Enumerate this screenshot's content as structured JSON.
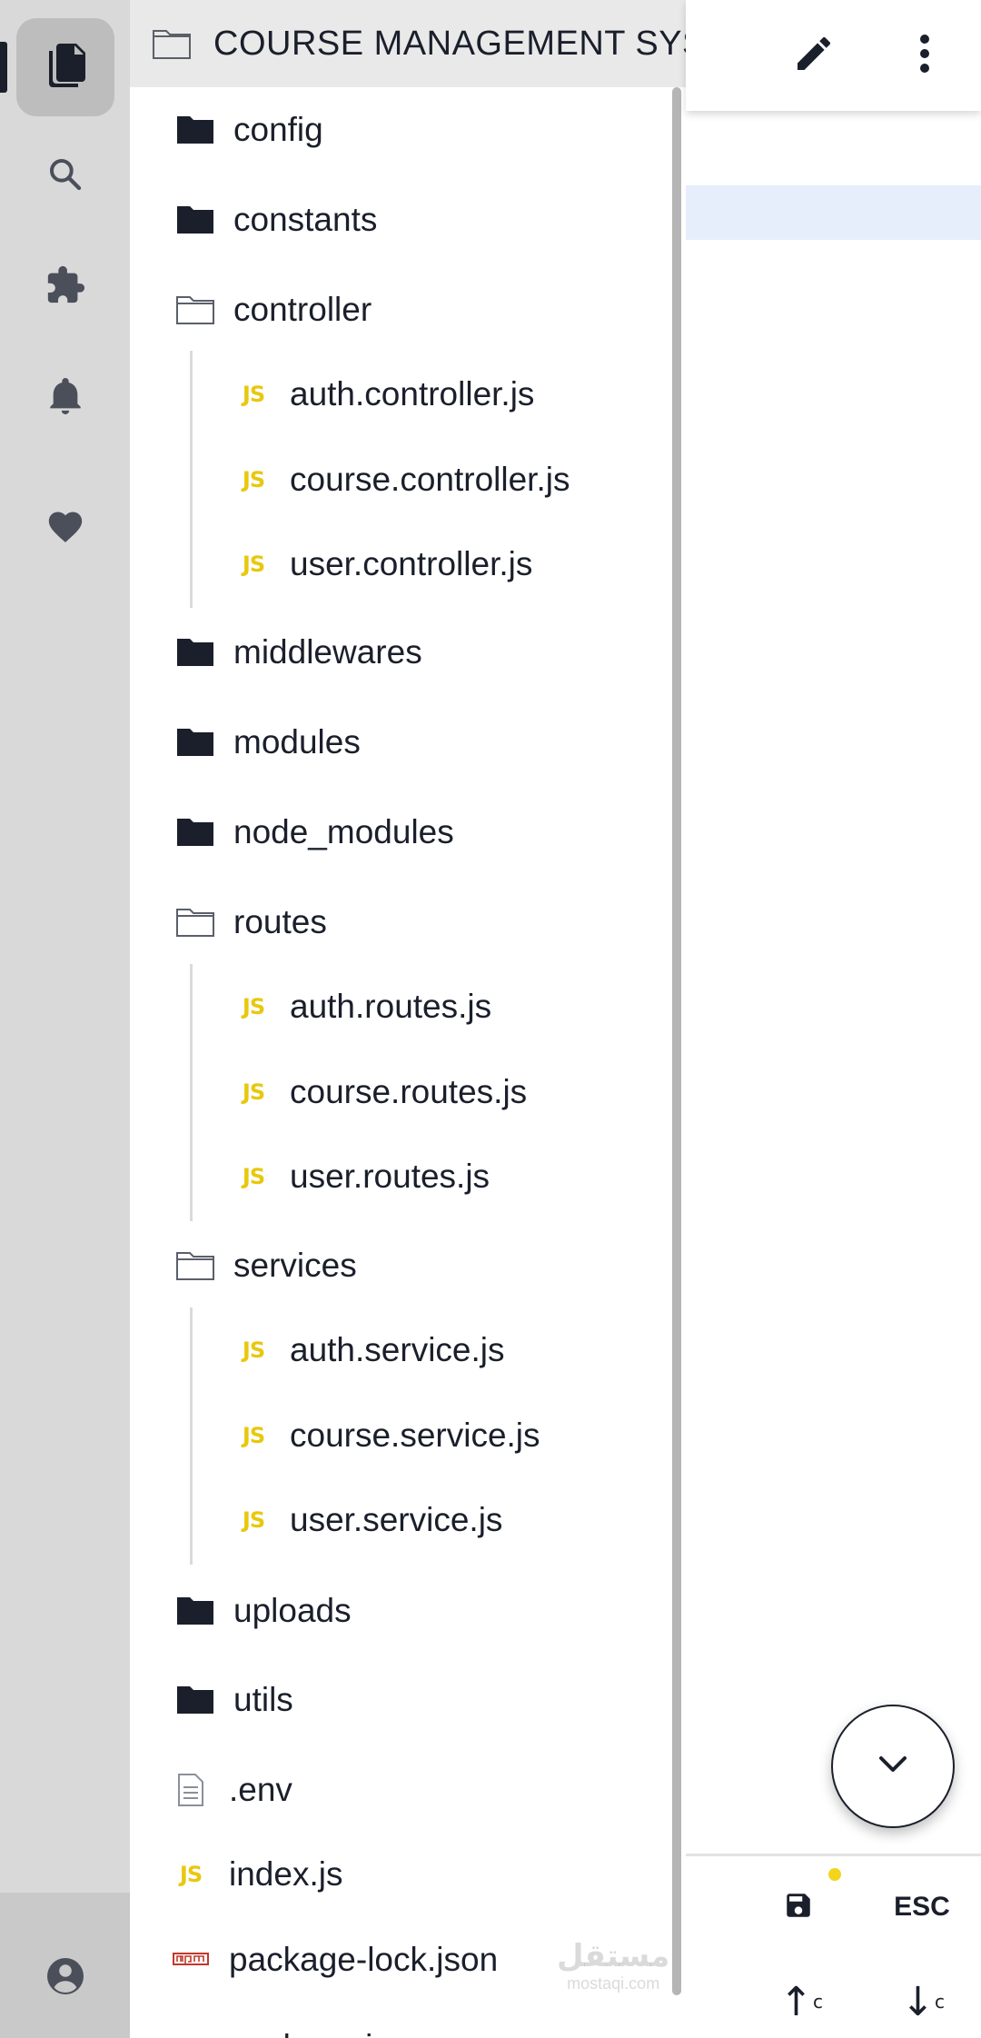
{
  "activity_bar": {
    "items": [
      {
        "name": "explorer",
        "icon": "files-icon"
      },
      {
        "name": "search",
        "icon": "search-icon"
      },
      {
        "name": "extensions",
        "icon": "puzzle-icon"
      },
      {
        "name": "notifications",
        "icon": "bell-icon"
      },
      {
        "name": "favorites",
        "icon": "heart-icon"
      }
    ],
    "account_icon": "account-icon"
  },
  "explorer": {
    "title": "COURSE MANAGEMENT SYSTEM",
    "items": [
      {
        "label": "config",
        "type": "folder-closed"
      },
      {
        "label": "constants",
        "type": "folder-closed"
      },
      {
        "label": "controller",
        "type": "folder-open"
      },
      {
        "label": "auth.controller.js",
        "type": "js"
      },
      {
        "label": "course.controller.js",
        "type": "js"
      },
      {
        "label": "user.controller.js",
        "type": "js"
      },
      {
        "label": "middlewares",
        "type": "folder-closed"
      },
      {
        "label": "modules",
        "type": "folder-closed"
      },
      {
        "label": "node_modules",
        "type": "folder-closed"
      },
      {
        "label": "routes",
        "type": "folder-open"
      },
      {
        "label": "auth.routes.js",
        "type": "js"
      },
      {
        "label": "course.routes.js",
        "type": "js"
      },
      {
        "label": "user.routes.js",
        "type": "js"
      },
      {
        "label": "services",
        "type": "folder-open"
      },
      {
        "label": "auth.service.js",
        "type": "js"
      },
      {
        "label": "course.service.js",
        "type": "js"
      },
      {
        "label": "user.service.js",
        "type": "js"
      },
      {
        "label": "uploads",
        "type": "folder-closed"
      },
      {
        "label": "utils",
        "type": "folder-closed"
      },
      {
        "label": ".env",
        "type": "text-file"
      },
      {
        "label": "index.js",
        "type": "js"
      },
      {
        "label": "package-lock.json",
        "type": "npm"
      },
      {
        "label": "package.json",
        "type": "npm"
      }
    ],
    "js_badge": "JS"
  },
  "editor": {
    "edit_icon": "pencil-icon",
    "menu_icon": "more-vertical-icon",
    "fab_icon": "chevron-down-icon",
    "save_icon": "save-icon",
    "esc_label": "ESC",
    "up_key": "↑",
    "down_key": "↓",
    "key_mod": "c"
  },
  "watermark": {
    "text": "مستقل",
    "sub": "mostaqi.com"
  },
  "colors": {
    "activity_bg": "#d9d9d9",
    "header_bg": "#e9e9e9",
    "js_yellow": "#e8c80f",
    "folder_dark": "#1a1f2b",
    "highlight": "#e6eefc"
  }
}
